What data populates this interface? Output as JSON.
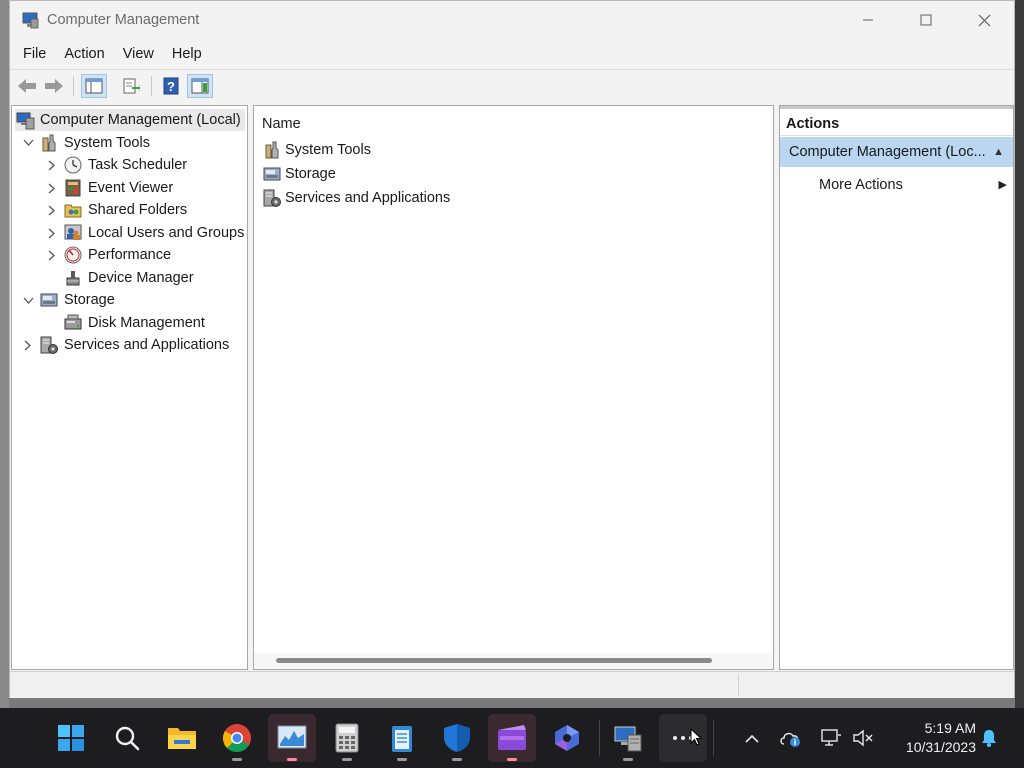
{
  "window": {
    "title": "Computer Management"
  },
  "menu": [
    "File",
    "Action",
    "View",
    "Help"
  ],
  "tree": {
    "root": "Computer Management (Local)",
    "system_tools": "System Tools",
    "task_scheduler": "Task Scheduler",
    "event_viewer": "Event Viewer",
    "shared_folders": "Shared Folders",
    "local_users": "Local Users and Groups",
    "performance": "Performance",
    "device_manager": "Device Manager",
    "storage": "Storage",
    "disk_management": "Disk Management",
    "services": "Services and Applications"
  },
  "list": {
    "header": "Name",
    "items": [
      "System Tools",
      "Storage",
      "Services and Applications"
    ]
  },
  "actions": {
    "title": "Actions",
    "group": "Computer Management (Loc...",
    "more": "More Actions"
  },
  "taskbar": {
    "time": "5:19 AM",
    "date": "10/31/2023"
  },
  "colors": {
    "selection": "#b9d7f0",
    "taskbar": "#1d1d1f",
    "window": "#f3f3f3"
  }
}
